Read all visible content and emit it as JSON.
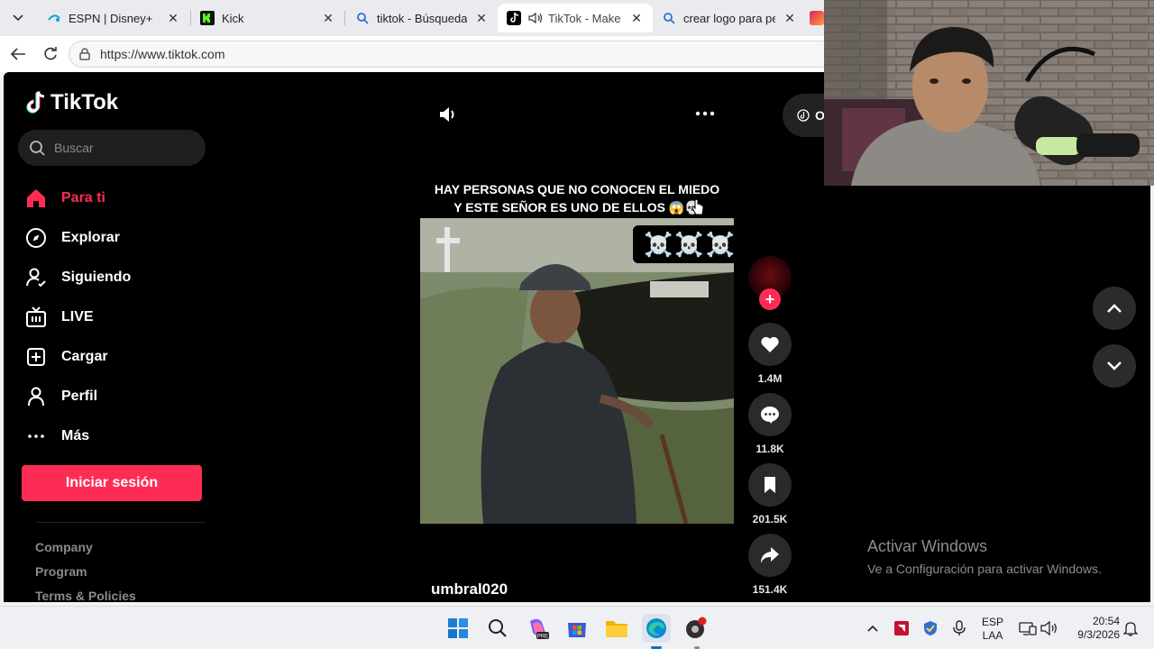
{
  "browser": {
    "tabs": [
      {
        "title": "ESPN | Disney+",
        "icon": "espn-icon"
      },
      {
        "title": "Kick",
        "icon": "kick-icon"
      },
      {
        "title": "tiktok - Búsqueda",
        "icon": "search-icon"
      },
      {
        "title": "TikTok - Make Yo",
        "icon": "tiktok-icon",
        "active": true,
        "audio": true
      },
      {
        "title": "crear logo para perfil",
        "icon": "search-icon"
      }
    ],
    "url": "https://www.tiktok.com"
  },
  "tiktok": {
    "logo": "TikTok",
    "search_placeholder": "Buscar",
    "menu": [
      {
        "label": "Para ti",
        "icon": "home-icon",
        "active": true
      },
      {
        "label": "Explorar",
        "icon": "compass-icon"
      },
      {
        "label": "Siguiendo",
        "icon": "following-icon"
      },
      {
        "label": "LIVE",
        "icon": "live-icon"
      },
      {
        "label": "Cargar",
        "icon": "upload-icon"
      },
      {
        "label": "Perfil",
        "icon": "profile-icon"
      },
      {
        "label": "Más",
        "icon": "more-icon"
      }
    ],
    "login_label": "Iniciar sesión",
    "footer_links": [
      "Company",
      "Program",
      "Terms & Policies"
    ],
    "video": {
      "caption_line1": "HAY PERSONAS QUE NO CONOCEN EL MIEDO",
      "caption_line2": "Y ESTE SEÑOR ES UNO DE ELLOS 😱💀",
      "badge": "☠️☠️☠️",
      "username": "umbral020"
    },
    "actions": {
      "likes": "1.4M",
      "comments": "11.8K",
      "saves": "201.5K",
      "shares": "151.4K"
    },
    "partial_button": "O"
  },
  "watermark": {
    "title": "Activar Windows",
    "subtitle": "Ve a Configuración para activar Windows."
  },
  "taskbar": {
    "lang": "ESP",
    "layout": "LAA",
    "time": "20:54",
    "date": "9/3/2026"
  },
  "colors": {
    "tiktok_accent": "#fe2c55",
    "page_bg": "#000000"
  }
}
